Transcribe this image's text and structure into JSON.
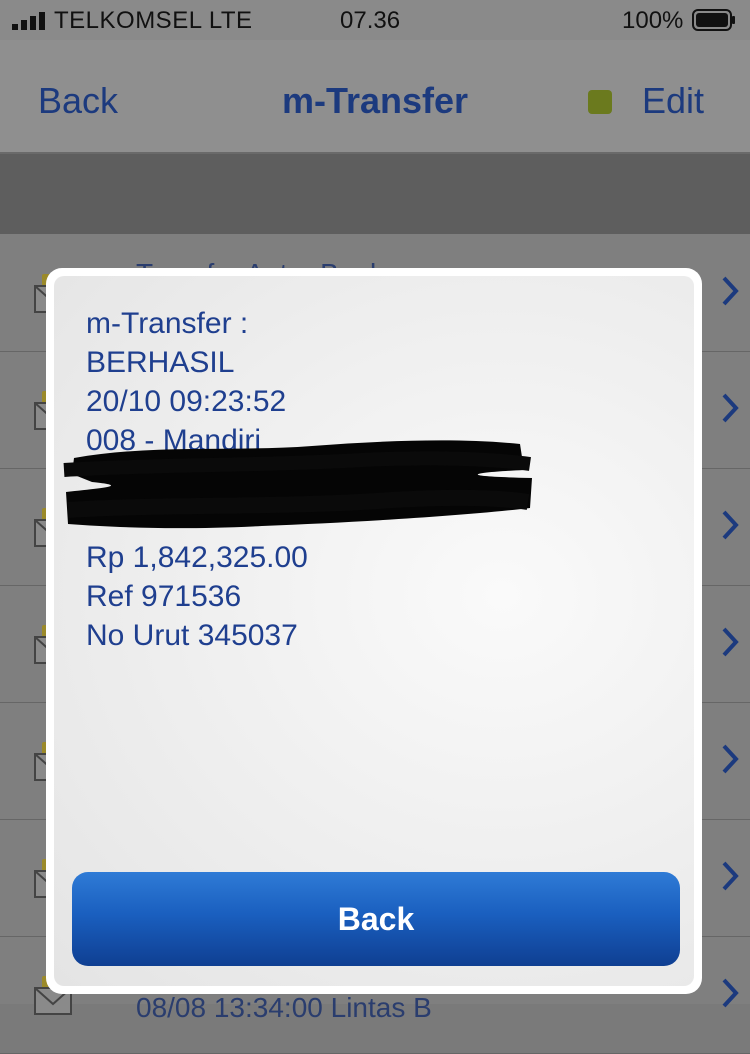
{
  "status_bar": {
    "carrier": "TELKOMSEL  LTE",
    "time": "07.36",
    "battery": "100%"
  },
  "nav": {
    "back_label": "Back",
    "title": "m-Transfer",
    "edit_label": "Edit",
    "indicator_color": "#6b7a1e"
  },
  "list": {
    "first_row_text": "Transfer Antar Bank",
    "last_row_text": "08/08 13:34:00 Lintas B"
  },
  "modal": {
    "lines": [
      "m-Transfer :",
      "BERHASIL",
      "20/10 09:23:52",
      "008 - Mandiri",
      "",
      "",
      "Rp 1,842,325.00",
      "Ref 971536",
      "No Urut 345037"
    ],
    "button_label": "Back"
  },
  "colors": {
    "text_blue": "#1f3f8f",
    "button_blue": "#1a5fbf"
  }
}
